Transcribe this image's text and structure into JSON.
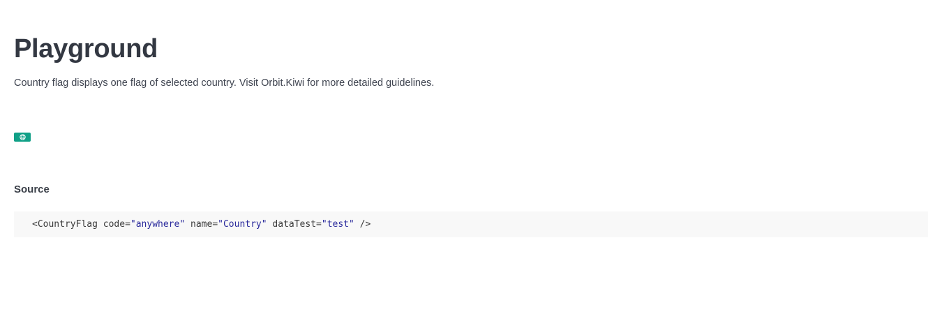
{
  "header": {
    "title": "Playground",
    "description": "Country flag displays one flag of selected country. Visit Orbit.Kiwi for more detailed guidelines."
  },
  "preview": {
    "flag_icon": "globe-icon",
    "flag_color": "#11a087"
  },
  "source": {
    "heading": "Source",
    "code": {
      "open": "<",
      "tag": "CountryFlag",
      "attrs": [
        {
          "name": "code",
          "value": "anywhere"
        },
        {
          "name": "name",
          "value": "Country"
        },
        {
          "name": "dataTest",
          "value": "test"
        }
      ],
      "close": " />"
    }
  }
}
